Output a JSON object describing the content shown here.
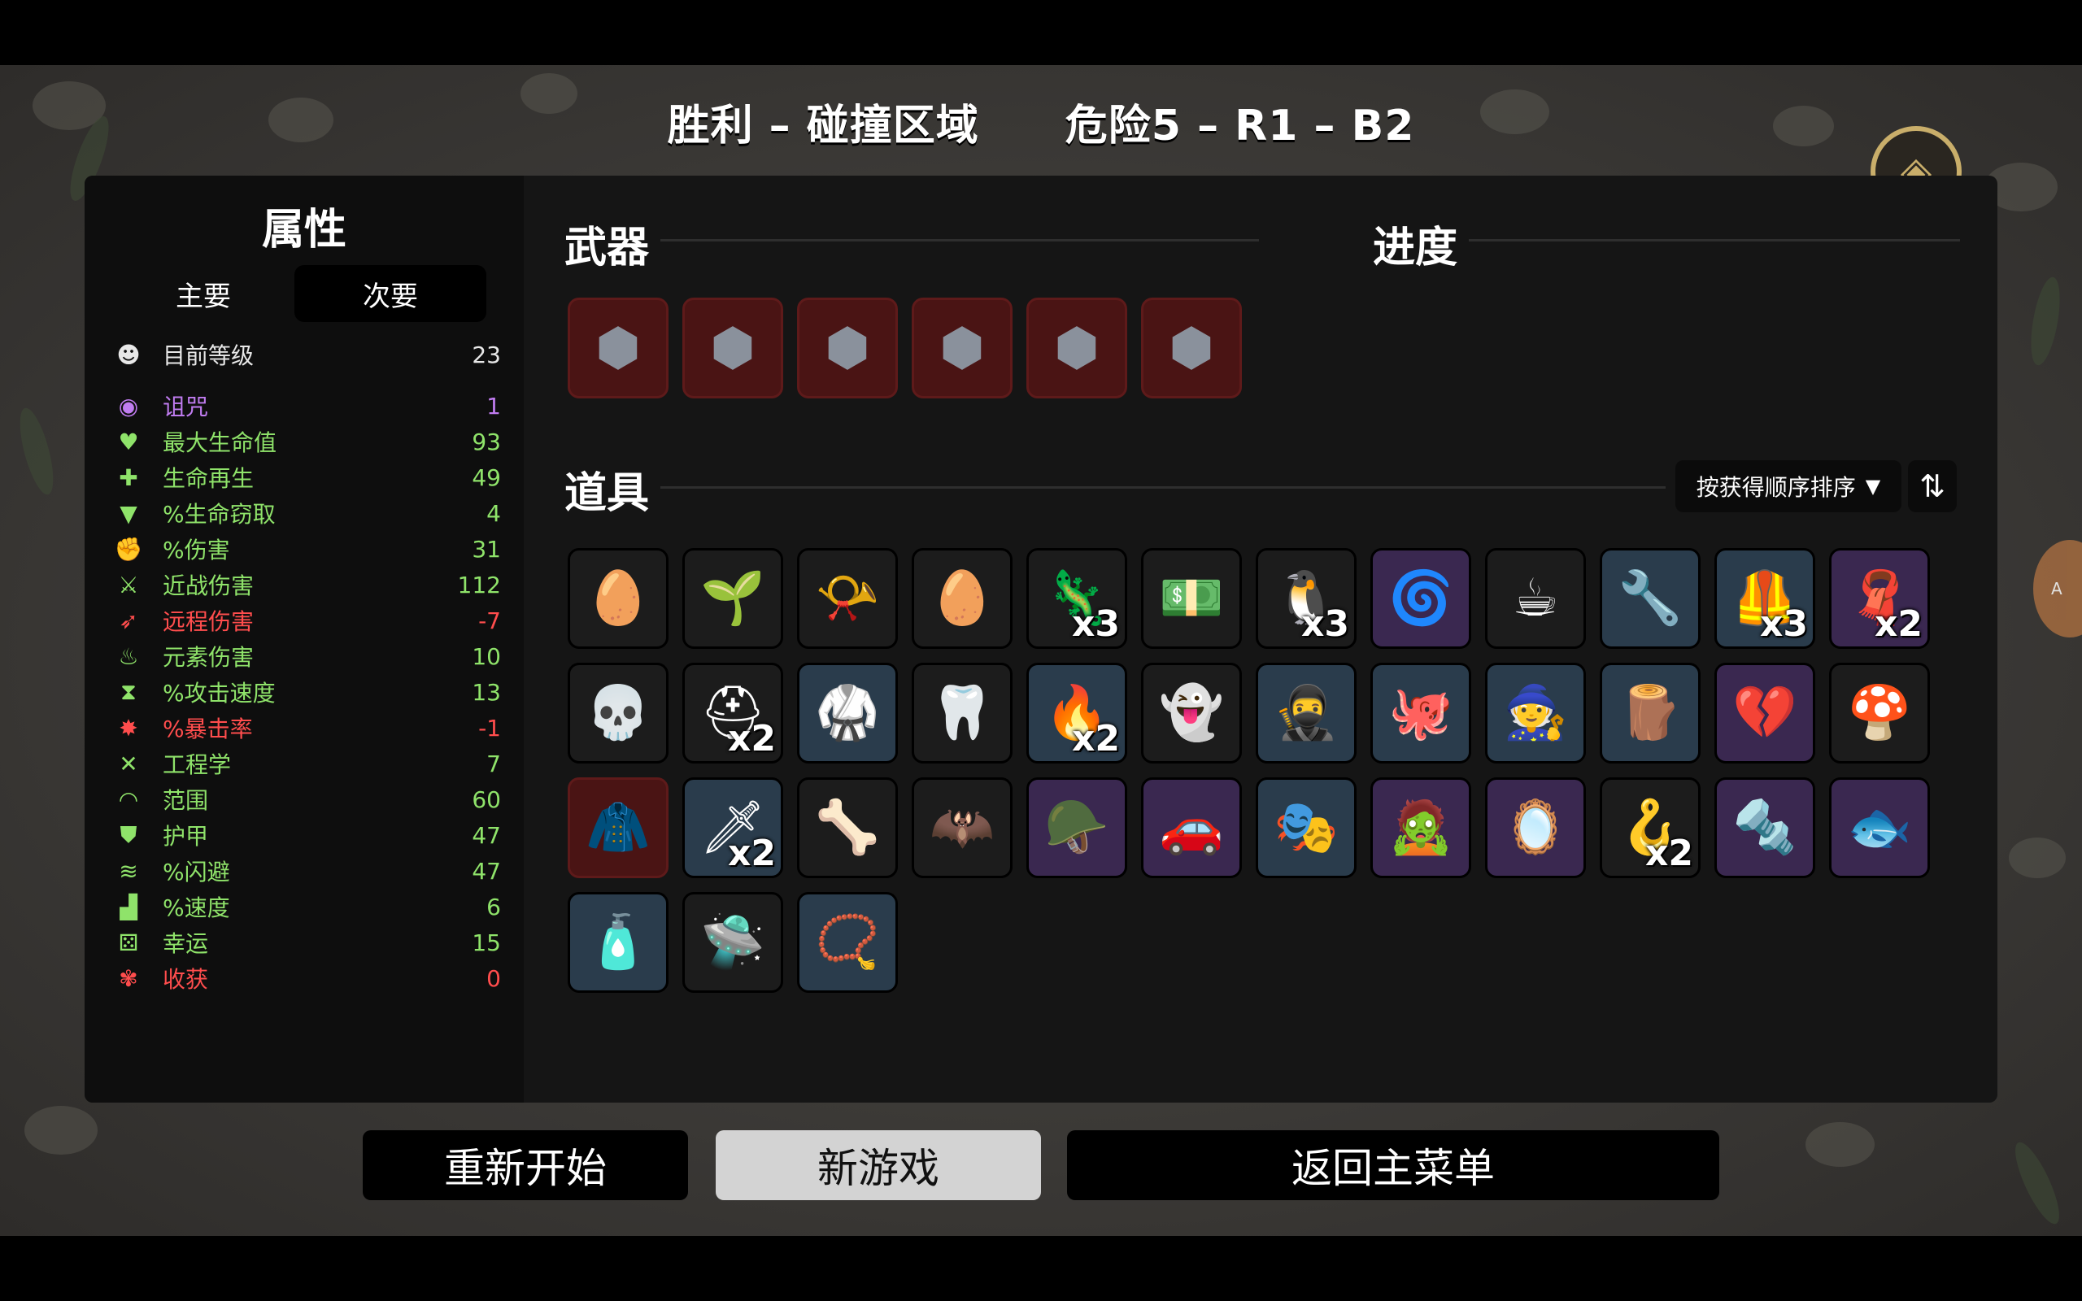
{
  "title": "胜利 – 碰撞区域　　危险5 – R1 – B2",
  "stats": {
    "heading": "属性",
    "tabs": {
      "main": "主要",
      "secondary": "次要"
    },
    "level": {
      "name": "目前等级",
      "value": "23",
      "icon": "level-icon"
    },
    "rows": [
      {
        "name": "诅咒",
        "value": "1",
        "color": "#c07cf0",
        "icon": "eye-icon",
        "glyph": "◉"
      },
      {
        "name": "最大生命值",
        "value": "93",
        "color": "#8fe36a",
        "icon": "heart-icon",
        "glyph": "♥"
      },
      {
        "name": "生命再生",
        "value": "49",
        "color": "#8fe36a",
        "icon": "heart-plus-icon",
        "glyph": "✚"
      },
      {
        "name": "%生命窃取",
        "value": "4",
        "color": "#8fe36a",
        "icon": "fangs-icon",
        "glyph": "▼"
      },
      {
        "name": "%伤害",
        "value": "31",
        "color": "#8fe36a",
        "icon": "muscle-icon",
        "glyph": "✊"
      },
      {
        "name": "近战伤害",
        "value": "112",
        "color": "#8fe36a",
        "icon": "sword-icon",
        "glyph": "⚔"
      },
      {
        "name": "远程伤害",
        "value": "-7",
        "color": "#ff4d4d",
        "icon": "bow-icon",
        "glyph": "➶"
      },
      {
        "name": "元素伤害",
        "value": "10",
        "color": "#8fe36a",
        "icon": "flame-icon",
        "glyph": "♨"
      },
      {
        "name": "%攻击速度",
        "value": "13",
        "color": "#8fe36a",
        "icon": "hourglass-icon",
        "glyph": "⧗"
      },
      {
        "name": "%暴击率",
        "value": "-1",
        "color": "#ff4d4d",
        "icon": "crit-icon",
        "glyph": "✸"
      },
      {
        "name": "工程学",
        "value": "7",
        "color": "#8fe36a",
        "icon": "wrench-icon",
        "glyph": "✕"
      },
      {
        "name": "范围",
        "value": "60",
        "color": "#8fe36a",
        "icon": "range-icon",
        "glyph": "◠"
      },
      {
        "name": "护甲",
        "value": "47",
        "color": "#8fe36a",
        "icon": "shield-icon",
        "glyph": "⛊"
      },
      {
        "name": "%闪避",
        "value": "47",
        "color": "#8fe36a",
        "icon": "dodge-icon",
        "glyph": "≋"
      },
      {
        "name": "%速度",
        "value": "6",
        "color": "#8fe36a",
        "icon": "boot-icon",
        "glyph": "▟"
      },
      {
        "name": "幸运",
        "value": "15",
        "color": "#8fe36a",
        "icon": "dice-icon",
        "glyph": "⚄"
      },
      {
        "name": "收获",
        "value": "0",
        "color": "#ff4d4d",
        "icon": "wheat-icon",
        "glyph": "✾"
      }
    ]
  },
  "weapons": {
    "heading": "武器",
    "items": [
      {
        "icon": "rock-weapon-icon",
        "glyph": "⬢"
      },
      {
        "icon": "rock-weapon-icon",
        "glyph": "⬢"
      },
      {
        "icon": "rock-weapon-icon",
        "glyph": "⬢"
      },
      {
        "icon": "rock-weapon-icon",
        "glyph": "⬢"
      },
      {
        "icon": "rock-weapon-icon",
        "glyph": "⬢"
      },
      {
        "icon": "rock-weapon-icon",
        "glyph": "⬢"
      }
    ]
  },
  "progress": {
    "heading": "进度"
  },
  "items": {
    "heading": "道具",
    "sort_label": "按获得顺序排序",
    "sort_toggle": "⇅",
    "list": [
      {
        "icon": "egg-mustache-icon",
        "glyph": "🥚",
        "tier": "dark",
        "count": ""
      },
      {
        "icon": "sprout-icon",
        "glyph": "🌱",
        "tier": "dark",
        "count": ""
      },
      {
        "icon": "whistle-icon",
        "glyph": "📯",
        "tier": "dark",
        "count": ""
      },
      {
        "icon": "alien-egg-icon",
        "glyph": "🥚",
        "tier": "dark",
        "count": ""
      },
      {
        "icon": "lizard-icon",
        "glyph": "🦎",
        "tier": "dark",
        "count": "x3"
      },
      {
        "icon": "banknote-icon",
        "glyph": "💵",
        "tier": "dark",
        "count": ""
      },
      {
        "icon": "penguin-icon",
        "glyph": "🐧",
        "tier": "dark",
        "count": "x3"
      },
      {
        "icon": "spring-icon",
        "glyph": "🌀",
        "tier": "purple",
        "count": ""
      },
      {
        "icon": "coffee-cup-icon",
        "glyph": "☕",
        "tier": "dark",
        "count": ""
      },
      {
        "icon": "grappling-hook-icon",
        "glyph": "🔧",
        "tier": "blue",
        "count": ""
      },
      {
        "icon": "leather-vest-icon",
        "glyph": "🦺",
        "tier": "blue",
        "count": "x3"
      },
      {
        "icon": "scarf-icon",
        "glyph": "🧣",
        "tier": "purple",
        "count": "x2"
      },
      {
        "icon": "goat-skull-icon",
        "glyph": "💀",
        "tier": "dark",
        "count": ""
      },
      {
        "icon": "helmet-icon",
        "glyph": "⛑",
        "tier": "dark",
        "count": "x2"
      },
      {
        "icon": "black-belt-icon",
        "glyph": "🥋",
        "tier": "blue",
        "count": ""
      },
      {
        "icon": "tooth-icon",
        "glyph": "🦷",
        "tier": "dark",
        "count": ""
      },
      {
        "icon": "campfire-icon",
        "glyph": "🔥",
        "tier": "blue",
        "count": "x2"
      },
      {
        "icon": "hooded-ghost-icon",
        "glyph": "👻",
        "tier": "dark",
        "count": ""
      },
      {
        "icon": "ninja-ball-icon",
        "glyph": "🥷",
        "tier": "blue",
        "count": ""
      },
      {
        "icon": "octopus-icon",
        "glyph": "🐙",
        "tier": "blue",
        "count": ""
      },
      {
        "icon": "wizard-icon",
        "glyph": "🧙",
        "tier": "blue",
        "count": ""
      },
      {
        "icon": "wood-plank-icon",
        "glyph": "🪵",
        "tier": "blue",
        "count": ""
      },
      {
        "icon": "frozen-heart-icon",
        "glyph": "💔",
        "tier": "purple",
        "count": ""
      },
      {
        "icon": "mushroom-icon",
        "glyph": "🍄",
        "tier": "dark",
        "count": ""
      },
      {
        "icon": "red-cape-icon",
        "glyph": "🧥",
        "tier": "red",
        "count": ""
      },
      {
        "icon": "scythe-blade-icon",
        "glyph": "🗡",
        "tier": "blue",
        "count": "x2"
      },
      {
        "icon": "fang-icon",
        "glyph": "🦴",
        "tier": "dark",
        "count": ""
      },
      {
        "icon": "bat-icon",
        "glyph": "🦇",
        "tier": "dark",
        "count": ""
      },
      {
        "icon": "knight-helmet-icon",
        "glyph": "🪖",
        "tier": "purple",
        "count": ""
      },
      {
        "icon": "toy-car-icon",
        "glyph": "🚗",
        "tier": "purple",
        "count": ""
      },
      {
        "icon": "gold-mask-icon",
        "glyph": "🎭",
        "tier": "blue",
        "count": ""
      },
      {
        "icon": "zombie-head-icon",
        "glyph": "🧟",
        "tier": "purple",
        "count": ""
      },
      {
        "icon": "broken-mirror-icon",
        "glyph": "🪞",
        "tier": "purple",
        "count": ""
      },
      {
        "icon": "claw-icon",
        "glyph": "🪝",
        "tier": "dark",
        "count": "x2"
      },
      {
        "icon": "screw-icon",
        "glyph": "🔩",
        "tier": "purple",
        "count": ""
      },
      {
        "icon": "goldfish-icon",
        "glyph": "🐟",
        "tier": "purple",
        "count": ""
      },
      {
        "icon": "sauce-bottle-icon",
        "glyph": "🧴",
        "tier": "blue",
        "count": ""
      },
      {
        "icon": "hover-car-icon",
        "glyph": "🛸",
        "tier": "dark",
        "count": ""
      },
      {
        "icon": "amulet-icon",
        "glyph": "📿",
        "tier": "blue",
        "count": ""
      }
    ]
  },
  "buttons": {
    "restart": "重新开始",
    "new_game": "新游戏",
    "main_menu": "返回主菜单"
  }
}
